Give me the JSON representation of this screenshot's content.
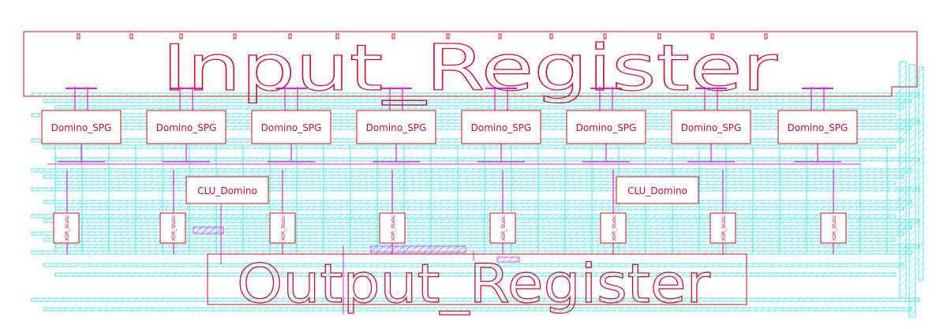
{
  "colors": {
    "cell_outline": "#d01010",
    "metal_cyan": "#33e0e8",
    "metal_magenta": "#e020e0",
    "background": "#ffffff"
  },
  "input_register": {
    "label": "Input_Register"
  },
  "output_register": {
    "label": "Output_Register"
  },
  "spg_cells": [
    {
      "label": "Domino_SPG"
    },
    {
      "label": "Domino_SPG"
    },
    {
      "label": "Domino_SPG"
    },
    {
      "label": "Domino_SPG"
    },
    {
      "label": "Domino_SPG"
    },
    {
      "label": "Domino_SPG"
    },
    {
      "label": "Domino_SPG"
    },
    {
      "label": "Domino_SPG"
    }
  ],
  "clu_cells": [
    {
      "label": "CLU_Domino"
    },
    {
      "label": "CLU_Domino"
    }
  ],
  "xor_cells": [
    {
      "label": "XOR_Static"
    },
    {
      "label": "XOR_Static"
    },
    {
      "label": "XOR_Static"
    },
    {
      "label": "XOR_Static"
    },
    {
      "label": "XOR_Static"
    },
    {
      "label": "XOR_Static"
    },
    {
      "label": "XOR_Static"
    },
    {
      "label": "XOR_Static"
    }
  ]
}
